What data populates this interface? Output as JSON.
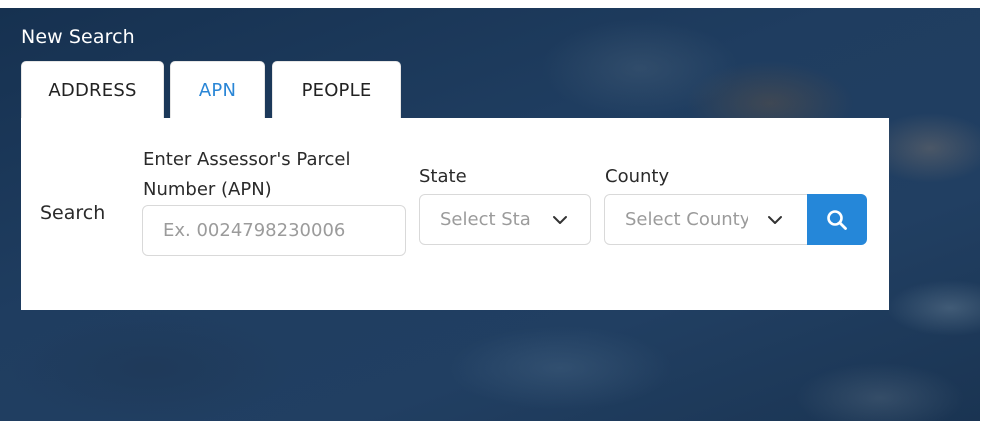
{
  "header": {
    "title": "New Search"
  },
  "tabs": [
    {
      "label": "ADDRESS",
      "active": false
    },
    {
      "label": "APN",
      "active": true
    },
    {
      "label": "PEOPLE",
      "active": false
    }
  ],
  "form": {
    "search_label": "Search",
    "apn": {
      "label": "Enter Assessor's Parcel Number (APN)",
      "placeholder": "Ex. 0024798230006",
      "value": ""
    },
    "state": {
      "label": "State",
      "selected": "Select State"
    },
    "county": {
      "label": "County",
      "selected": "Select County"
    },
    "search_button_icon": "search-icon"
  },
  "colors": {
    "accent": "#2587d9",
    "active_tab_text": "#2a86d6",
    "background": "#1f3d60"
  }
}
